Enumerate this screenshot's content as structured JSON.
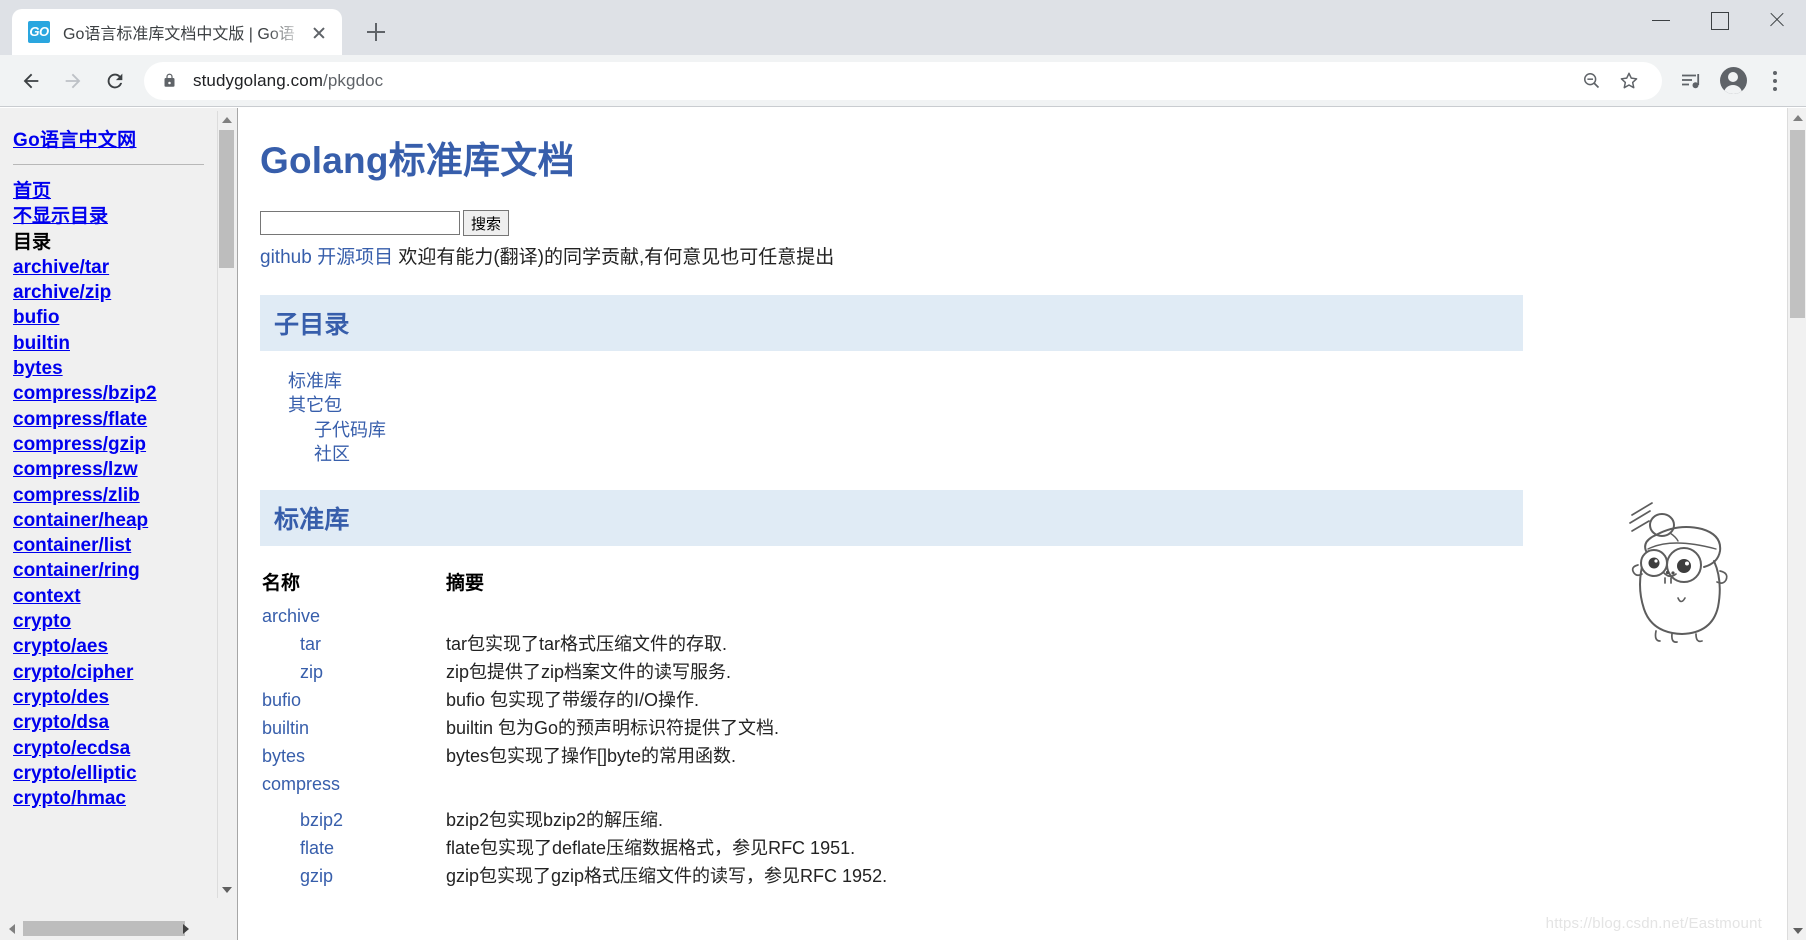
{
  "browser": {
    "tab": {
      "favicon_text": "GO",
      "title": "Go语言标准库文档中文版 | Go语",
      "close_icon": "close-icon"
    },
    "new_tab_label": "+",
    "window_controls": {
      "minimize": "–",
      "maximize": "□",
      "close": "✕"
    },
    "toolbar": {
      "back_icon": "back-arrow-icon",
      "forward_icon": "forward-arrow-icon",
      "reload_icon": "reload-icon",
      "lock_icon": "lock-icon",
      "url_host": "studygolang.com",
      "url_path": "/pkgdoc",
      "zoom_out_icon": "zoom-out-icon",
      "bookmark_icon": "star-icon",
      "media_icon": "media-playlist-icon",
      "profile_icon": "profile-avatar-icon",
      "menu_icon": "kebab-menu-icon"
    }
  },
  "sidebar": {
    "site_title": "Go语言中文网",
    "nav": [
      {
        "label": "首页",
        "type": "link"
      },
      {
        "label": "不显示目录",
        "type": "link"
      },
      {
        "label": "目录",
        "type": "plain"
      }
    ],
    "packages": [
      "archive/tar",
      "archive/zip",
      "bufio",
      "builtin",
      "bytes",
      "compress/bzip2",
      "compress/flate",
      "compress/gzip",
      "compress/lzw",
      "compress/zlib",
      "container/heap",
      "container/list",
      "container/ring",
      "context",
      "crypto",
      "crypto/aes",
      "crypto/cipher",
      "crypto/des",
      "crypto/dsa",
      "crypto/ecdsa",
      "crypto/elliptic",
      "crypto/hmac"
    ]
  },
  "main": {
    "title": "Golang标准库文档",
    "search": {
      "value": "",
      "placeholder": "",
      "button_label": "搜索"
    },
    "github_line": {
      "link1": "github",
      "link2": "开源项目",
      "text": " 欢迎有能力(翻译)的同学贡献,有何意见也可任意提出"
    },
    "subdirectory_section": {
      "heading": "子目录",
      "items": [
        {
          "label": "标准库",
          "indent": 0
        },
        {
          "label": "其它包",
          "indent": 0
        },
        {
          "label": "子代码库",
          "indent": 1
        },
        {
          "label": "社区",
          "indent": 1
        }
      ]
    },
    "stdlib_section": {
      "heading": "标准库",
      "columns": [
        "名称",
        "摘要"
      ],
      "rows": [
        {
          "name": "archive",
          "level": 1,
          "summary": ""
        },
        {
          "name": "tar",
          "level": 2,
          "summary": "tar包实现了tar格式压缩文件的存取."
        },
        {
          "name": "zip",
          "level": 2,
          "summary": "zip包提供了zip档案文件的读写服务."
        },
        {
          "name": "bufio",
          "level": 1,
          "summary": "bufio 包实现了带缓存的I/O操作."
        },
        {
          "name": "builtin",
          "level": 1,
          "summary": "builtin 包为Go的预声明标识符提供了文档."
        },
        {
          "name": "bytes",
          "level": 1,
          "summary": "bytes包实现了操作[]byte的常用函数."
        },
        {
          "name": "compress",
          "level": 1,
          "summary": ""
        },
        {
          "name": "bzip2",
          "level": 2,
          "summary": "bzip2包实现bzip2的解压缩."
        },
        {
          "name": "flate",
          "level": 2,
          "summary": "flate包实现了deflate压缩数据格式，参见RFC 1951."
        },
        {
          "name": "gzip",
          "level": 2,
          "summary": "gzip包实现了gzip格式压缩文件的读写，参见RFC 1952."
        }
      ]
    },
    "mascot": "go-gopher-mascot",
    "watermark": "https://blog.csdn.net/Eastmount"
  },
  "colors": {
    "accent_blue": "#375eab",
    "banner_bg": "#e0ebf5",
    "link_blue": "#0000ee",
    "chrome_titlebar": "#dee1e6",
    "chrome_toolbar": "#f1f3f4"
  }
}
